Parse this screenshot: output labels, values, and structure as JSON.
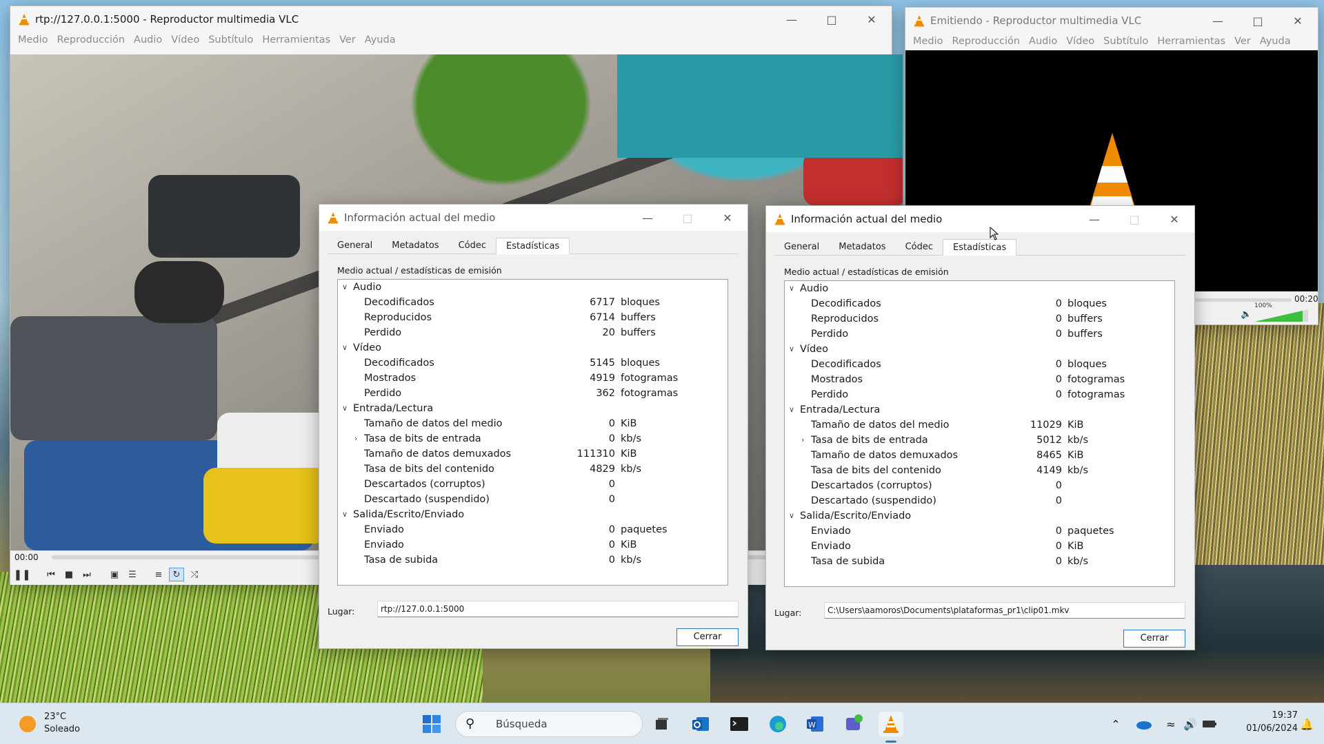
{
  "main_window": {
    "title": "rtp://127.0.0.1:5000 - Reproductor multimedia VLC",
    "menu": [
      "Medio",
      "Reproducción",
      "Audio",
      "Vídeo",
      "Subtítulo",
      "Herramientas",
      "Ver",
      "Ayuda"
    ],
    "time_elapsed": "00:00"
  },
  "stream_window": {
    "title": "Emitiendo - Reproductor multimedia VLC",
    "menu": [
      "Medio",
      "Reproducción",
      "Audio",
      "Vídeo",
      "Subtítulo",
      "Herramientas",
      "Ver",
      "Ayuda"
    ],
    "time_remaining": "00:20",
    "volume_label": "100%"
  },
  "dialog_left": {
    "title": "Información actual del medio",
    "tabs": [
      "General",
      "Metadatos",
      "Códec",
      "Estadísticas"
    ],
    "selected_tab": "Estadísticas",
    "subheading": "Medio actual / estadísticas de emisión",
    "rows": [
      {
        "level": 0,
        "label": "Audio",
        "expander": "v"
      },
      {
        "level": 1,
        "label": "Decodificados",
        "value": "6717",
        "unit": "bloques"
      },
      {
        "level": 1,
        "label": "Reproducidos",
        "value": "6714",
        "unit": "buffers"
      },
      {
        "level": 1,
        "label": "Perdido",
        "value": "20",
        "unit": "buffers"
      },
      {
        "level": 0,
        "label": "Vídeo",
        "expander": "v"
      },
      {
        "level": 1,
        "label": "Decodificados",
        "value": "5145",
        "unit": "bloques"
      },
      {
        "level": 1,
        "label": "Mostrados",
        "value": "4919",
        "unit": "fotogramas"
      },
      {
        "level": 1,
        "label": "Perdido",
        "value": "362",
        "unit": "fotogramas"
      },
      {
        "level": 0,
        "label": "Entrada/Lectura",
        "expander": "v"
      },
      {
        "level": 1,
        "label": "Tamaño de datos del medio",
        "value": "0",
        "unit": "KiB"
      },
      {
        "level": 1,
        "label": "Tasa de bits de entrada",
        "value": "0",
        "unit": "kb/s",
        "expander": ">"
      },
      {
        "level": 1,
        "label": "Tamaño de datos demuxados",
        "value": "111310",
        "unit": "KiB"
      },
      {
        "level": 1,
        "label": "Tasa de bits del contenido",
        "value": "4829",
        "unit": "kb/s"
      },
      {
        "level": 1,
        "label": "Descartados (corruptos)",
        "value": "0",
        "unit": ""
      },
      {
        "level": 1,
        "label": "Descartado (suspendido)",
        "value": "0",
        "unit": ""
      },
      {
        "level": 0,
        "label": "Salida/Escrito/Enviado",
        "expander": "v"
      },
      {
        "level": 1,
        "label": "Enviado",
        "value": "0",
        "unit": "paquetes"
      },
      {
        "level": 1,
        "label": "Enviado",
        "value": "0",
        "unit": "KiB"
      },
      {
        "level": 1,
        "label": "Tasa de subida",
        "value": "0",
        "unit": "kb/s"
      }
    ],
    "lugar_label": "Lugar:",
    "lugar_value": "rtp://127.0.0.1:5000",
    "close_label": "Cerrar"
  },
  "dialog_right": {
    "title": "Información actual del medio",
    "tabs": [
      "General",
      "Metadatos",
      "Códec",
      "Estadísticas"
    ],
    "selected_tab": "Estadísticas",
    "subheading": "Medio actual / estadísticas de emisión",
    "rows": [
      {
        "level": 0,
        "label": "Audio",
        "expander": "v"
      },
      {
        "level": 1,
        "label": "Decodificados",
        "value": "0",
        "unit": "bloques"
      },
      {
        "level": 1,
        "label": "Reproducidos",
        "value": "0",
        "unit": "buffers"
      },
      {
        "level": 1,
        "label": "Perdido",
        "value": "0",
        "unit": "buffers"
      },
      {
        "level": 0,
        "label": "Vídeo",
        "expander": "v"
      },
      {
        "level": 1,
        "label": "Decodificados",
        "value": "0",
        "unit": "bloques"
      },
      {
        "level": 1,
        "label": "Mostrados",
        "value": "0",
        "unit": "fotogramas"
      },
      {
        "level": 1,
        "label": "Perdido",
        "value": "0",
        "unit": "fotogramas"
      },
      {
        "level": 0,
        "label": "Entrada/Lectura",
        "expander": "v"
      },
      {
        "level": 1,
        "label": "Tamaño de datos del medio",
        "value": "11029",
        "unit": "KiB"
      },
      {
        "level": 1,
        "label": "Tasa de bits de entrada",
        "value": "5012",
        "unit": "kb/s",
        "expander": ">"
      },
      {
        "level": 1,
        "label": "Tamaño de datos demuxados",
        "value": "8465",
        "unit": "KiB"
      },
      {
        "level": 1,
        "label": "Tasa de bits del contenido",
        "value": "4149",
        "unit": "kb/s"
      },
      {
        "level": 1,
        "label": "Descartados (corruptos)",
        "value": "0",
        "unit": ""
      },
      {
        "level": 1,
        "label": "Descartado (suspendido)",
        "value": "0",
        "unit": ""
      },
      {
        "level": 0,
        "label": "Salida/Escrito/Enviado",
        "expander": "v"
      },
      {
        "level": 1,
        "label": "Enviado",
        "value": "0",
        "unit": "paquetes"
      },
      {
        "level": 1,
        "label": "Enviado",
        "value": "0",
        "unit": "KiB"
      },
      {
        "level": 1,
        "label": "Tasa de subida",
        "value": "0",
        "unit": "kb/s"
      }
    ],
    "lugar_label": "Lugar:",
    "lugar_value": "C:\\Users\\aamoros\\Documents\\plataformas_pr1\\clip01.mkv",
    "close_label": "Cerrar"
  },
  "taskbar": {
    "weather_temp": "23°C",
    "weather_desc": "Soleado",
    "search_placeholder": "Búsqueda",
    "clock_time": "19:37",
    "clock_date": "01/06/2024"
  },
  "colors": {
    "vlc_orange": "#f08a00",
    "accent_blue": "#2f78c8",
    "volume_green": "#3fbf3f"
  }
}
